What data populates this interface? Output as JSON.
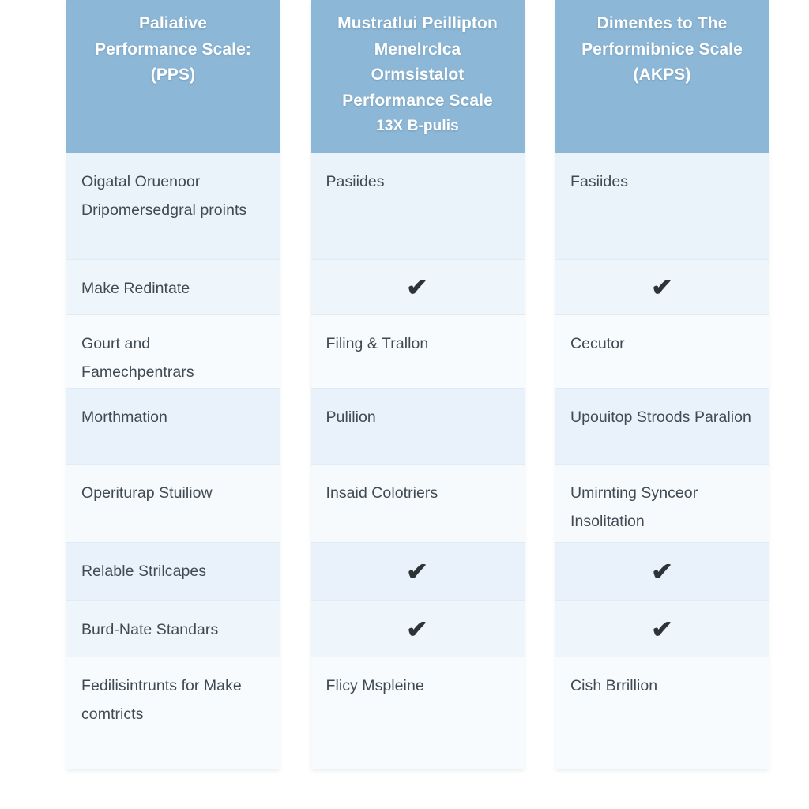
{
  "theme": {
    "header_bg": "#8cb7d6",
    "header_text": "#ffffff",
    "row_tint_a": "#eaf2fa",
    "row_tint_b": "#f7fbfd",
    "body_text": "#414a52",
    "divider": "#dfecf6",
    "page_bg": "#ffffff",
    "check_color": "#2e3338"
  },
  "table": {
    "columns": [
      {
        "key": "pps",
        "header_lines": [
          "Paliative",
          "Performance Scale:",
          "(PPS)"
        ],
        "cells": [
          {
            "type": "text",
            "text": "Oigatal Oruenoor Dripomersedgral proints"
          },
          {
            "type": "text",
            "text": "Make Redintate"
          },
          {
            "type": "text",
            "text": "Gourt and Famechpentrars"
          },
          {
            "type": "text",
            "text": "Morthmation"
          },
          {
            "type": "text",
            "text": "Operiturap Stuiliow"
          },
          {
            "type": "text",
            "text": "Relable Strilcapes"
          },
          {
            "type": "text",
            "text": "Burd-Nate Standars"
          },
          {
            "type": "text",
            "text": "Fedilisintrunts for Make comtricts"
          }
        ]
      },
      {
        "key": "mps",
        "header_lines": [
          "Mustratlui Peillipton",
          "Menelrclca",
          "Ormsistalot",
          "Performance Scale",
          "13X B-pulis"
        ],
        "cells": [
          {
            "type": "text",
            "text": "Pasiides"
          },
          {
            "type": "check",
            "text": "✔"
          },
          {
            "type": "text",
            "text": "Filing & Trallon"
          },
          {
            "type": "text",
            "text": "Pulilion"
          },
          {
            "type": "text",
            "text": "Insaid Colotriers"
          },
          {
            "type": "check",
            "text": "✔"
          },
          {
            "type": "check",
            "text": "✔"
          },
          {
            "type": "text",
            "text": "Flicy Mspleine"
          }
        ]
      },
      {
        "key": "akps",
        "header_lines": [
          "Dimentes to The",
          "Performibnice Scale",
          "(AKPS)"
        ],
        "cells": [
          {
            "type": "text",
            "text": "Fasiides"
          },
          {
            "type": "check",
            "text": "✔"
          },
          {
            "type": "text",
            "text": "Cecutor"
          },
          {
            "type": "text",
            "text": "Upouitop Stroods Paralion"
          },
          {
            "type": "text",
            "text": "Umirnting Synceor Insolitation"
          },
          {
            "type": "check",
            "text": "✔"
          },
          {
            "type": "check",
            "text": "✔"
          },
          {
            "type": "text",
            "text": "Cish Brrillion"
          }
        ]
      }
    ]
  }
}
